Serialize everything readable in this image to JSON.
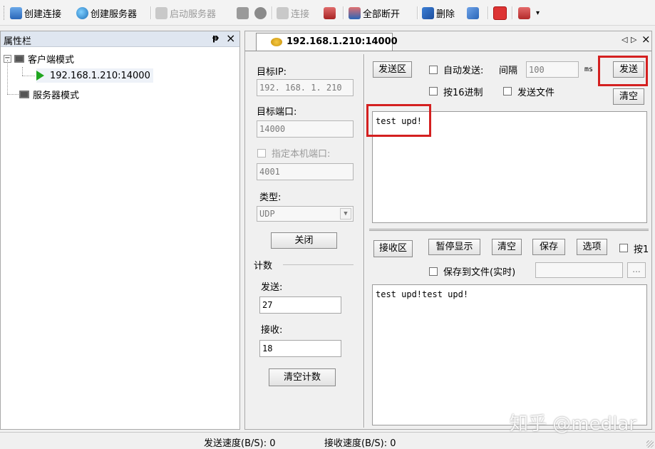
{
  "toolbar": {
    "create_connection": "创建连接",
    "create_server": "创建服务器",
    "start_server": "启动服务器",
    "connect": "连接",
    "disconnect_all": "全部断开",
    "delete": "删除"
  },
  "left_panel": {
    "title": "属性栏",
    "pin": "ᵽ",
    "close": "×",
    "tree": {
      "client_mode": "客户端模式",
      "client_connection": "192.168.1.210:14000",
      "server_mode": "服务器模式"
    }
  },
  "tab": {
    "label": "192.168.1.210:14000",
    "nav_prev": "◁",
    "nav_next": "▷",
    "close": "×"
  },
  "settings": {
    "target_ip_label": "目标IP:",
    "target_ip": "192. 168. 1. 210",
    "target_port_label": "目标端口:",
    "target_port": "14000",
    "local_port_label": "指定本机端口:",
    "local_port": "4001",
    "type_label": "类型:",
    "type_value": "UDP",
    "close_button": "关闭",
    "count_label": "计数",
    "sent_label": "发送:",
    "sent_value": "27",
    "recv_label": "接收:",
    "recv_value": "18",
    "clear_count_button": "清空计数"
  },
  "send": {
    "area_label": "发送区",
    "auto_send": "自动发送:",
    "interval_label": "间隔",
    "interval_value": "100",
    "interval_unit": "ms",
    "send_button": "发送",
    "hex": "按16进制",
    "send_file": "发送文件",
    "clear_button": "清空",
    "content": "test upd!"
  },
  "receive": {
    "area_label": "接收区",
    "pause_button": "暂停显示",
    "clear_button": "清空",
    "save_button": "保存",
    "options_button": "选项",
    "hex_partial": "按1",
    "save_to_file": "保存到文件(实时)",
    "browse_button": "...",
    "content": "test upd!test upd!"
  },
  "status": {
    "send_speed": "发送速度(B/S): 0",
    "recv_speed": "接收速度(B/S): 0"
  },
  "watermark": "知乎 @medlar",
  "colors": {
    "highlight": "#d42020",
    "play_icon": "#1fa51f"
  }
}
